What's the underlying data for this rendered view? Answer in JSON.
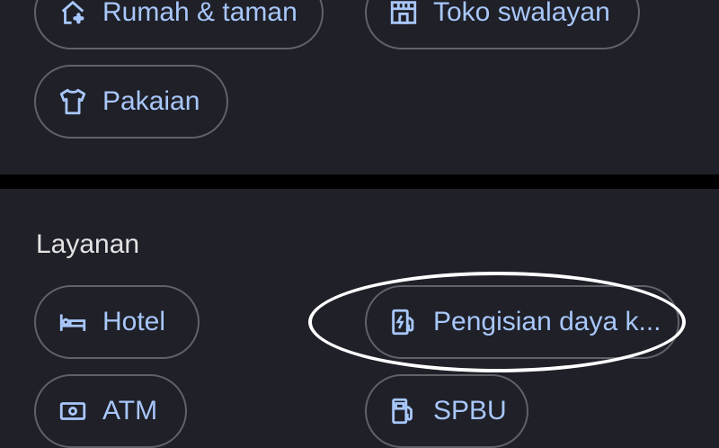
{
  "top_section": {
    "chips": [
      {
        "label": "Rumah & taman",
        "icon": "home-garden-icon"
      },
      {
        "label": "Toko swalayan",
        "icon": "grocery-store-icon"
      },
      {
        "label": "Pakaian",
        "icon": "shirt-icon"
      }
    ]
  },
  "services": {
    "title": "Layanan",
    "chips": [
      {
        "label": "Hotel",
        "icon": "bed-icon"
      },
      {
        "label": "Pengisian daya k...",
        "icon": "ev-charging-icon"
      },
      {
        "label": "ATM",
        "icon": "atm-icon"
      },
      {
        "label": "SPBU",
        "icon": "gas-station-icon"
      }
    ]
  },
  "colors": {
    "background": "#1f2028",
    "chip_text": "#a8c7fa",
    "chip_border": "#5f6368",
    "title_text": "#e3e3e3",
    "highlight": "#ffffff"
  }
}
